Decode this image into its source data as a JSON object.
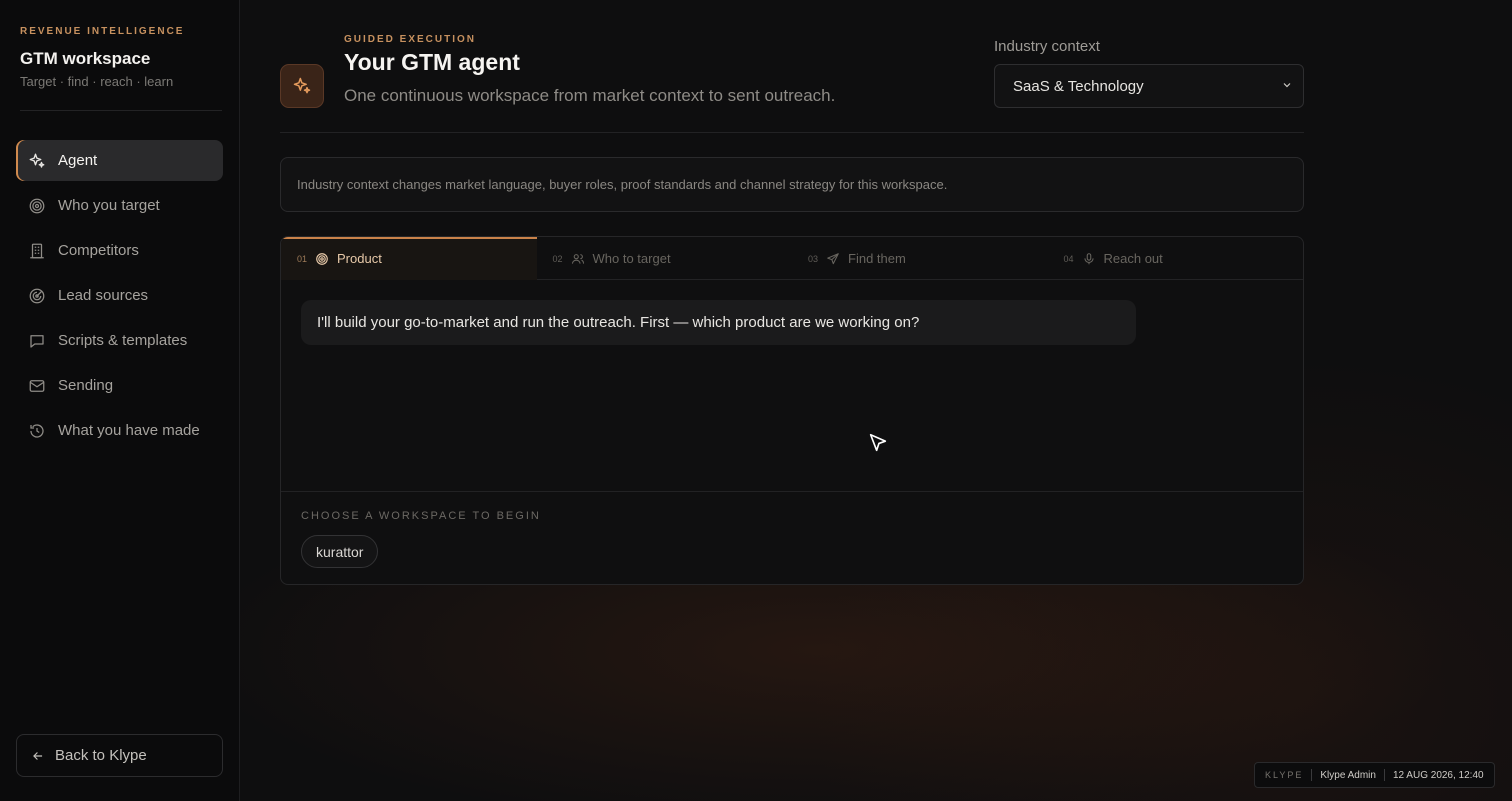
{
  "sidebar": {
    "eyebrow": "REVENUE INTELLIGENCE",
    "title": "GTM workspace",
    "subtitle": "Target · find · reach · learn",
    "items": [
      {
        "label": "Agent",
        "icon": "sparkle-icon",
        "active": true
      },
      {
        "label": "Who you target",
        "icon": "target-icon"
      },
      {
        "label": "Competitors",
        "icon": "building-icon"
      },
      {
        "label": "Lead sources",
        "icon": "radar-icon"
      },
      {
        "label": "Scripts & templates",
        "icon": "message-icon"
      },
      {
        "label": "Sending",
        "icon": "mail-icon"
      },
      {
        "label": "What you have made",
        "icon": "history-icon"
      }
    ],
    "back_label": "Back to Klype"
  },
  "header": {
    "eyebrow": "GUIDED EXECUTION",
    "title": "Your GTM agent",
    "subtitle": "One continuous workspace from market context to sent outreach.",
    "industry_label": "Industry context",
    "industry_value": "SaaS & Technology"
  },
  "notice": "Industry context changes market language, buyer roles, proof standards and channel strategy for this workspace.",
  "tabs": [
    {
      "num": "01",
      "label": "Product",
      "icon": "target-icon",
      "active": true
    },
    {
      "num": "02",
      "label": "Who to target",
      "icon": "users-icon"
    },
    {
      "num": "03",
      "label": "Find them",
      "icon": "send-icon"
    },
    {
      "num": "04",
      "label": "Reach out",
      "icon": "mic-icon"
    }
  ],
  "chat": {
    "message": "I'll build your go-to-market and run the outreach. First — which product are we working on?"
  },
  "workspace": {
    "label": "CHOOSE A WORKSPACE TO BEGIN",
    "options": [
      "kurattor"
    ]
  },
  "status": {
    "brand": "KLYPE",
    "user": "Klype Admin",
    "datetime": "12 AUG 2026, 12:40"
  },
  "colors": {
    "accent": "#c9824a",
    "background": "#0e0e0f"
  }
}
